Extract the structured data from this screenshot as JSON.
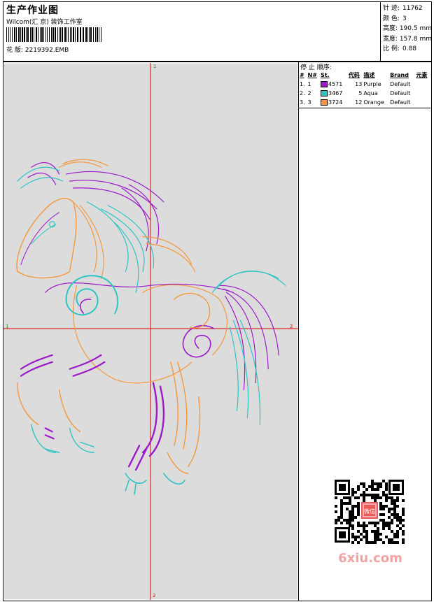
{
  "header": {
    "title": "生产作业图",
    "company": "Wilcom(汇 京) 装饰工作室",
    "design_label": "花 版:",
    "design_file": "2219392.EMB"
  },
  "stats": [
    {
      "label": "针 迹:",
      "value": "11762"
    },
    {
      "label": "颜 色:",
      "value": "3"
    },
    {
      "label": "高度:",
      "value": "190.5 mm"
    },
    {
      "label": "宽度:",
      "value": "157.8 mm"
    },
    {
      "label": "比 例:",
      "value": "0.88"
    }
  ],
  "canvas": {
    "marker_top": "1",
    "marker_left": "1",
    "marker_right": "2",
    "marker_bottom": "2",
    "background": "#dcdcdc",
    "axis_color": "#e00000"
  },
  "sequence": {
    "title": "停 止 顺序:",
    "headers": [
      "#",
      "N#",
      "St.",
      "代码",
      "描述",
      "Brand",
      "元素"
    ],
    "rows": [
      {
        "index": "1.",
        "n": "1",
        "code": "4571",
        "st": "13",
        "name": "Purple",
        "brand": "Default",
        "color": "#9b19c8"
      },
      {
        "index": "2.",
        "n": "2",
        "code": "3467",
        "st": "5",
        "name": "Aqua",
        "brand": "Default",
        "color": "#2ec4c4"
      },
      {
        "index": "3.",
        "n": "3",
        "code": "3724",
        "st": "12",
        "name": "Orange",
        "brand": "Default",
        "color": "#f5973a"
      }
    ]
  },
  "watermark": {
    "qr_label": "微信",
    "site": "6xiu.com"
  }
}
